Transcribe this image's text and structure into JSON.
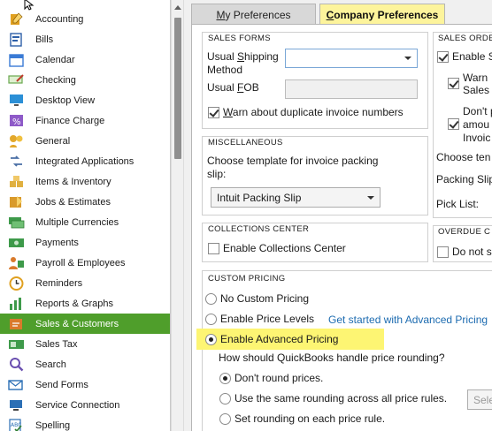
{
  "sidebar": {
    "items": [
      {
        "label": "Accounting",
        "icon": "accounting-icon",
        "color": "#e0a020"
      },
      {
        "label": "Bills",
        "icon": "bills-icon",
        "color": "#2d5fa8"
      },
      {
        "label": "Calendar",
        "icon": "calendar-icon",
        "color": "#3a7bd5"
      },
      {
        "label": "Checking",
        "icon": "checking-icon",
        "color": "#6aa84f"
      },
      {
        "label": "Desktop View",
        "icon": "desktop-view-icon",
        "color": "#2b8fd6"
      },
      {
        "label": "Finance Charge",
        "icon": "finance-charge-icon",
        "color": "#8e5ac8"
      },
      {
        "label": "General",
        "icon": "general-icon",
        "color": "#e3a82b"
      },
      {
        "label": "Integrated Applications",
        "icon": "integrated-apps-icon",
        "color": "#4a6fa5"
      },
      {
        "label": "Items & Inventory",
        "icon": "items-inventory-icon",
        "color": "#e0b040"
      },
      {
        "label": "Jobs & Estimates",
        "icon": "jobs-estimates-icon",
        "color": "#d99a2b"
      },
      {
        "label": "Multiple Currencies",
        "icon": "multiple-currencies-icon",
        "color": "#3e9a4a"
      },
      {
        "label": "Payments",
        "icon": "payments-icon",
        "color": "#3e9a4a"
      },
      {
        "label": "Payroll & Employees",
        "icon": "payroll-employees-icon",
        "color": "#d97a2b"
      },
      {
        "label": "Reminders",
        "icon": "reminders-icon",
        "color": "#e0a020"
      },
      {
        "label": "Reports & Graphs",
        "icon": "reports-graphs-icon",
        "color": "#3e9a4a"
      },
      {
        "label": "Sales & Customers",
        "icon": "sales-customers-icon",
        "color": "#d97a2b",
        "selected": true
      },
      {
        "label": "Sales Tax",
        "icon": "sales-tax-icon",
        "color": "#3e9a4a"
      },
      {
        "label": "Search",
        "icon": "search-icon",
        "color": "#6a4fb0"
      },
      {
        "label": "Send Forms",
        "icon": "send-forms-icon",
        "color": "#2b6fb5"
      },
      {
        "label": "Service Connection",
        "icon": "service-connection-icon",
        "color": "#2b6fb5"
      },
      {
        "label": "Spelling",
        "icon": "spelling-icon",
        "color": "#2b6fb5"
      }
    ]
  },
  "tabs": {
    "my_prefix": "M",
    "my_rest": "y Preferences",
    "company_prefix": "C",
    "company_rest": "ompany Preferences"
  },
  "sales_forms": {
    "title": "SALES FORMS",
    "shipping_label_a": "Usual ",
    "shipping_label_u": "S",
    "shipping_label_b": "hipping",
    "shipping_label_line2": "Method",
    "shipping_value": "",
    "fob_label_a": "Usual ",
    "fob_label_u": "F",
    "fob_label_b": "OB",
    "fob_value": "",
    "warn_dup_label_u": "W",
    "warn_dup_label_rest": "arn about duplicate invoice numbers",
    "warn_dup_checked": true
  },
  "miscellaneous": {
    "title": "MISCELLANEOUS",
    "template_label_line1": "Choose template for invoice packing",
    "template_label_line2": "slip:",
    "template_value": "Intuit Packing Slip"
  },
  "collections": {
    "title": "COLLECTIONS CENTER",
    "enable_label": "Enable Collections Center",
    "enable_checked": false
  },
  "sales_orders": {
    "title": "SALES ORDE",
    "enable_label": "Enable S",
    "enable_checked": true,
    "warn_line1": "Warn",
    "warn_line2": "Sales",
    "warn_checked": true,
    "dont_line1": "Don't p",
    "dont_line2": "amou",
    "dont_line3": "Invoic",
    "dont_checked": true,
    "choose_label": "Choose ten",
    "packing_label": "Packing Slip",
    "pick_label": "Pick List:"
  },
  "overdue": {
    "title": "OVERDUE C",
    "do_not_label": "Do not s",
    "do_not_checked": false
  },
  "custom_pricing": {
    "title": "CUSTOM PRICING",
    "no_custom": "No Custom Pricing",
    "price_levels": "Enable Price Levels",
    "advanced_link": "Get started with Advanced Pricing",
    "enable_advanced": "Enable Advanced Pricing",
    "selected": "enable_advanced",
    "rounding_question": "How should QuickBooks handle price rounding?",
    "round_none": "Don't round prices.",
    "round_same": "Use the same rounding across all price rules.",
    "round_each": "Set rounding on each price rule.",
    "rounding_selected": "round_none",
    "round_select_placeholder": "Sele"
  },
  "colors": {
    "selected_green": "#4f9e2b",
    "company_tab_yellow": "#fdf49c",
    "highlight_yellow": "#fdf573",
    "link_blue": "#1c6bb0"
  }
}
